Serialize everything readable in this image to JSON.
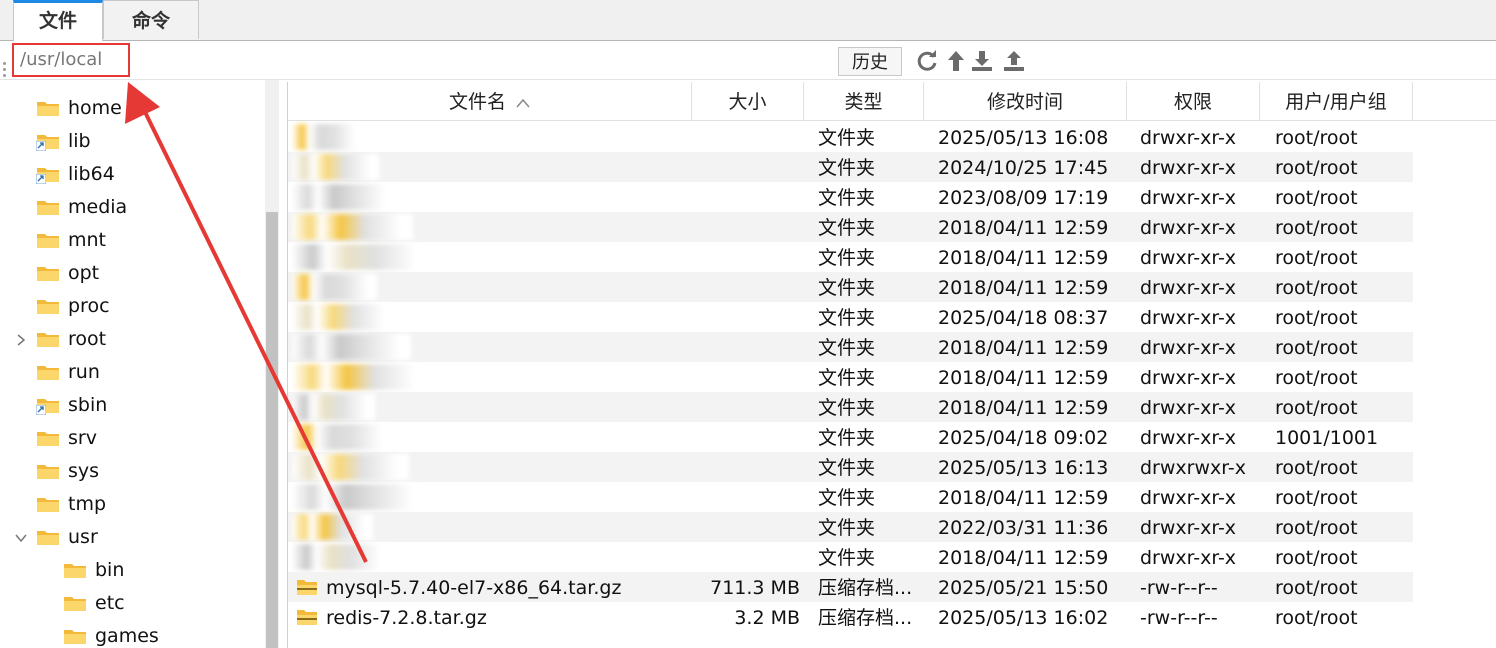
{
  "tabs": [
    {
      "label": "文件",
      "active": true
    },
    {
      "label": "命令",
      "active": false
    }
  ],
  "pathbar": {
    "path": "/usr/local",
    "history_label": "历史"
  },
  "toolbar_icons": [
    "refresh-icon",
    "up-arrow-icon",
    "download-icon",
    "upload-icon"
  ],
  "tree": [
    {
      "label": "home",
      "level": 0
    },
    {
      "label": "lib",
      "level": 0,
      "link": true
    },
    {
      "label": "lib64",
      "level": 0,
      "link": true
    },
    {
      "label": "media",
      "level": 0
    },
    {
      "label": "mnt",
      "level": 0
    },
    {
      "label": "opt",
      "level": 0
    },
    {
      "label": "proc",
      "level": 0
    },
    {
      "label": "root",
      "level": 0,
      "expandable": true,
      "lock": true
    },
    {
      "label": "run",
      "level": 0
    },
    {
      "label": "sbin",
      "level": 0,
      "link": true
    },
    {
      "label": "srv",
      "level": 0
    },
    {
      "label": "sys",
      "level": 0
    },
    {
      "label": "tmp",
      "level": 0
    },
    {
      "label": "usr",
      "level": 0,
      "expanded": true
    },
    {
      "label": "bin",
      "level": 1
    },
    {
      "label": "etc",
      "level": 1
    },
    {
      "label": "games",
      "level": 1
    }
  ],
  "columns": {
    "name": "文件名",
    "size": "大小",
    "type": "类型",
    "mtime": "修改时间",
    "perm": "权限",
    "owner": "用户/用户组"
  },
  "files": [
    {
      "name": "",
      "size": "",
      "type": "文件夹",
      "mtime": "2025/05/13 16:08",
      "perm": "drwxr-xr-x",
      "owner": "root/root",
      "blurred": true
    },
    {
      "name": "",
      "size": "",
      "type": "文件夹",
      "mtime": "2024/10/25 17:45",
      "perm": "drwxr-xr-x",
      "owner": "root/root",
      "blurred": true
    },
    {
      "name": "",
      "size": "",
      "type": "文件夹",
      "mtime": "2023/08/09 17:19",
      "perm": "drwxr-xr-x",
      "owner": "root/root",
      "blurred": true
    },
    {
      "name": "",
      "size": "",
      "type": "文件夹",
      "mtime": "2018/04/11 12:59",
      "perm": "drwxr-xr-x",
      "owner": "root/root",
      "blurred": true
    },
    {
      "name": "",
      "size": "",
      "type": "文件夹",
      "mtime": "2018/04/11 12:59",
      "perm": "drwxr-xr-x",
      "owner": "root/root",
      "blurred": true
    },
    {
      "name": "",
      "size": "",
      "type": "文件夹",
      "mtime": "2018/04/11 12:59",
      "perm": "drwxr-xr-x",
      "owner": "root/root",
      "blurred": true
    },
    {
      "name": "",
      "size": "",
      "type": "文件夹",
      "mtime": "2025/04/18 08:37",
      "perm": "drwxr-xr-x",
      "owner": "root/root",
      "blurred": true
    },
    {
      "name": "",
      "size": "",
      "type": "文件夹",
      "mtime": "2018/04/11 12:59",
      "perm": "drwxr-xr-x",
      "owner": "root/root",
      "blurred": true
    },
    {
      "name": "",
      "size": "",
      "type": "文件夹",
      "mtime": "2018/04/11 12:59",
      "perm": "drwxr-xr-x",
      "owner": "root/root",
      "blurred": true
    },
    {
      "name": "",
      "size": "",
      "type": "文件夹",
      "mtime": "2018/04/11 12:59",
      "perm": "drwxr-xr-x",
      "owner": "root/root",
      "blurred": true
    },
    {
      "name": "",
      "size": "",
      "type": "文件夹",
      "mtime": "2025/04/18 09:02",
      "perm": "drwxr-xr-x",
      "owner": "1001/1001",
      "blurred": true
    },
    {
      "name": "",
      "size": "",
      "type": "文件夹",
      "mtime": "2025/05/13 16:13",
      "perm": "drwxrwxr-x",
      "owner": "root/root",
      "blurred": true
    },
    {
      "name": "",
      "size": "",
      "type": "文件夹",
      "mtime": "2018/04/11 12:59",
      "perm": "drwxr-xr-x",
      "owner": "root/root",
      "blurred": true
    },
    {
      "name": "",
      "size": "",
      "type": "文件夹",
      "mtime": "2022/03/31 11:36",
      "perm": "drwxr-xr-x",
      "owner": "root/root",
      "blurred": true
    },
    {
      "name": "",
      "size": "",
      "type": "文件夹",
      "mtime": "2018/04/11 12:59",
      "perm": "drwxr-xr-x",
      "owner": "root/root",
      "blurred": true
    },
    {
      "name": "mysql-5.7.40-el7-x86_64.tar.gz",
      "size": "711.3 MB",
      "type": "压缩存档...",
      "mtime": "2025/05/21 15:50",
      "perm": "-rw-r--r--",
      "owner": "root/root",
      "blurred": false
    },
    {
      "name": "redis-7.2.8.tar.gz",
      "size": "3.2 MB",
      "type": "压缩存档...",
      "mtime": "2025/05/13 16:02",
      "perm": "-rw-r--r--",
      "owner": "root/root",
      "blurred": false
    }
  ],
  "colors": {
    "accent": "#1e88e5",
    "highlight_box": "#e53935",
    "arrow": "#e53935",
    "folder": "#f7c948",
    "row_alt": "#f3f3f3"
  }
}
